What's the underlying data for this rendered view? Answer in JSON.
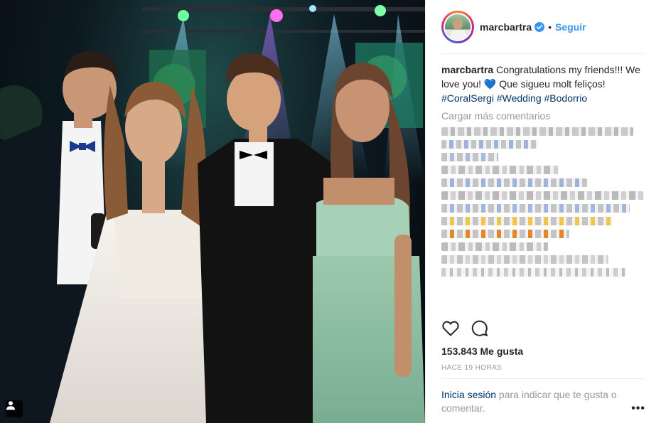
{
  "post": {
    "username": "marcbartra",
    "dot": "•",
    "follow_label": "Seguir",
    "caption": {
      "username": "marcbartra",
      "text": " Congratulations my friends!!! We love you! 💙 Que sigueu molt feliços! ",
      "hashtags": [
        "#CoralSergi",
        "#Wedding",
        "#Bodorrio"
      ]
    },
    "load_more_label": "Cargar más comentarios",
    "likes_label": "153.843 Me gusta",
    "timestamp": "HACE 19 HORAS",
    "login_link": "Inicia sesión",
    "login_rest": " para indicar que te gusta o comentar.",
    "more_options": "•••"
  },
  "icons": {
    "verified": "verified-badge-icon",
    "like": "heart-icon",
    "comment": "comment-bubble-icon",
    "user_tag": "user-tag-icon"
  },
  "colors": {
    "accent_blue": "#3897f0",
    "link_dark_blue": "#003569",
    "muted_gray": "#999999",
    "text_dark": "#262626"
  }
}
